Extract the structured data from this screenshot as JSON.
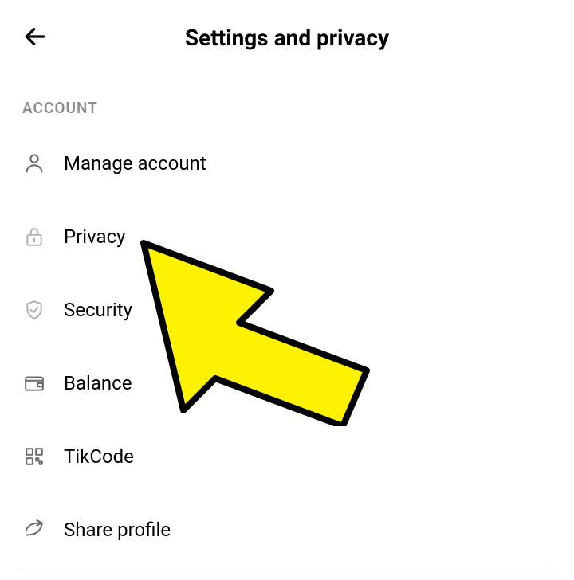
{
  "header": {
    "title": "Settings and privacy"
  },
  "section": {
    "label": "ACCOUNT"
  },
  "menu": {
    "items": [
      {
        "label": "Manage account"
      },
      {
        "label": "Privacy"
      },
      {
        "label": "Security"
      },
      {
        "label": "Balance"
      },
      {
        "label": "TikCode"
      },
      {
        "label": "Share profile"
      }
    ]
  }
}
